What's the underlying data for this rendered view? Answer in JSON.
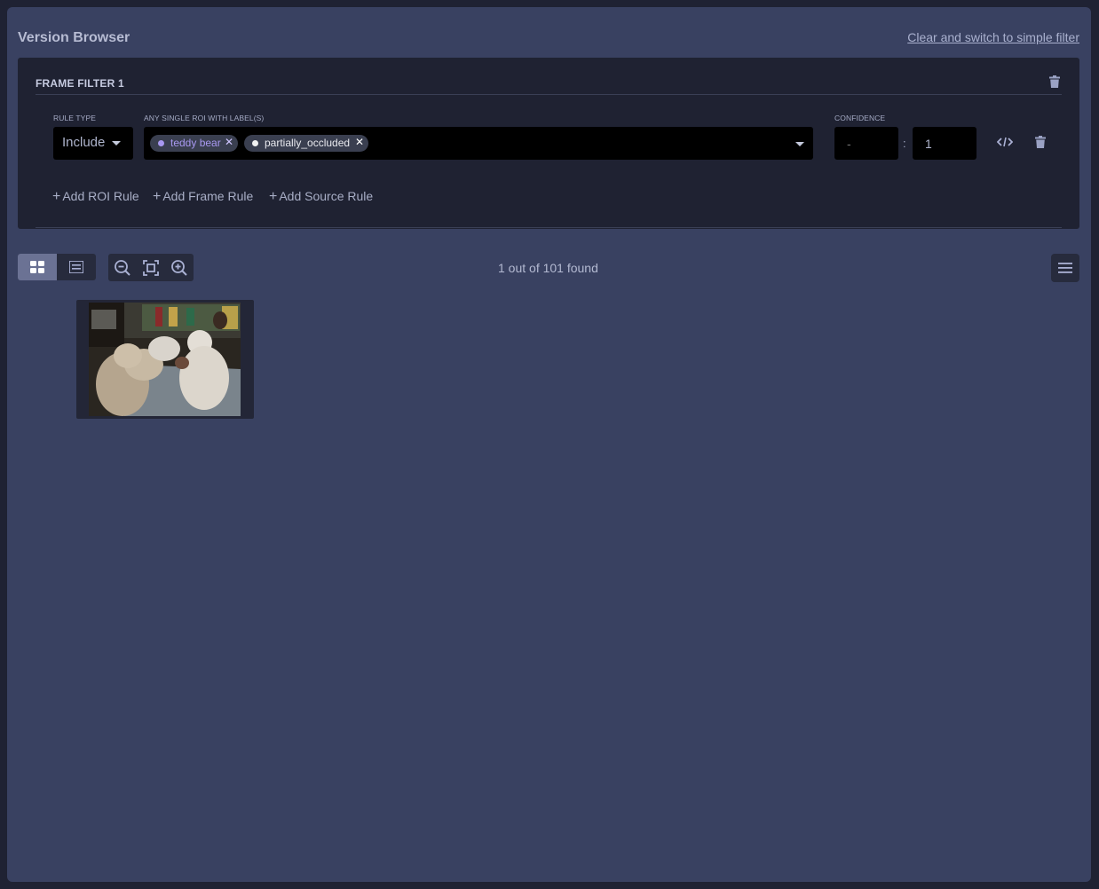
{
  "header": {
    "title": "Version Browser",
    "clear_link": "Clear and switch to simple filter"
  },
  "filter": {
    "name": "FRAME FILTER 1",
    "rule_type_label": "RULE TYPE",
    "rule_type_value": "Include",
    "labels_label": "ANY SINGLE ROI WITH LABEL(S)",
    "chips": [
      {
        "label": "teddy bear",
        "color": "#a898f0"
      },
      {
        "label": "partially_occluded",
        "color": "#f2f2f2"
      }
    ],
    "confidence_label": "CONFIDENCE",
    "confidence_min": "",
    "confidence_min_placeholder": "-",
    "confidence_separator": ":",
    "confidence_max": "1",
    "add_roi_rule": "Add ROI Rule",
    "add_frame_rule": "Add Frame Rule",
    "add_source_rule": "Add Source Rule"
  },
  "toolbar": {
    "view_modes": [
      "grid-view-icon",
      "list-view-icon"
    ],
    "active_view": "grid",
    "zoom_icons": [
      "zoom-out-icon",
      "fit-screen-icon",
      "zoom-in-icon"
    ],
    "result_count": "1 out of 101 found",
    "menu_icon": "hamburger-menu-icon"
  },
  "results": [
    {
      "type": "image-thumbnail"
    }
  ],
  "colors": {
    "background": "#1f2233",
    "panel": "#394161",
    "filter_box": "#1f2232",
    "input": "#000000",
    "accent_chip": "#a898f0",
    "active_toggle": "#6b7294"
  }
}
